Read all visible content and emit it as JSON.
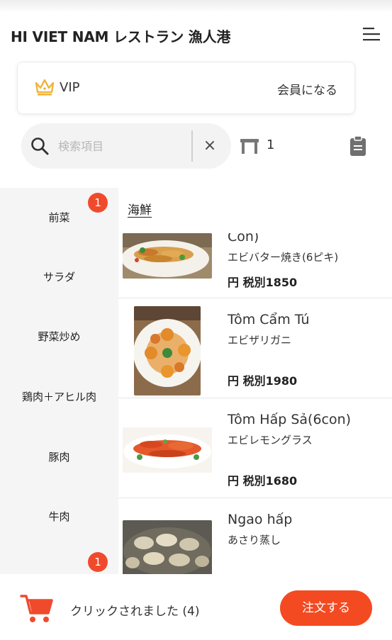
{
  "header": {
    "title": "HI VIET NAM レストラン 漁人港"
  },
  "vip": {
    "label": "VIP",
    "action": "会員になる"
  },
  "search": {
    "placeholder": "検索項目",
    "clear": "×"
  },
  "table": {
    "count": "1"
  },
  "categories": [
    {
      "label": "前菜",
      "badge": "1"
    },
    {
      "label": "サラダ"
    },
    {
      "label": "野菜炒め"
    },
    {
      "label": "鶏肉＋アヒル肉"
    },
    {
      "label": "豚肉"
    },
    {
      "label": "牛肉"
    },
    {
      "label": "",
      "badge": "1"
    }
  ],
  "menu": {
    "section": "海鮮",
    "items": [
      {
        "name": "Con)",
        "subtitle": "エビバター焼き(6ピキ)",
        "price": "円 税別1850"
      },
      {
        "name": "Tôm Cẩm Tú",
        "subtitle": "エビザリガニ",
        "price": "円 税別1980"
      },
      {
        "name": "Tôm Hấp Sả(6con)",
        "subtitle": "エビレモングラス",
        "price": "円 税別1680"
      },
      {
        "name": "Ngao hấp",
        "subtitle": "あさり蒸し",
        "price": ""
      }
    ]
  },
  "footer": {
    "cart_status": "クリックされました (4)",
    "order_label": "注文する"
  },
  "colors": {
    "accent": "#f44a22",
    "badge": "#f04a2c",
    "crown": "#f0b43a"
  }
}
